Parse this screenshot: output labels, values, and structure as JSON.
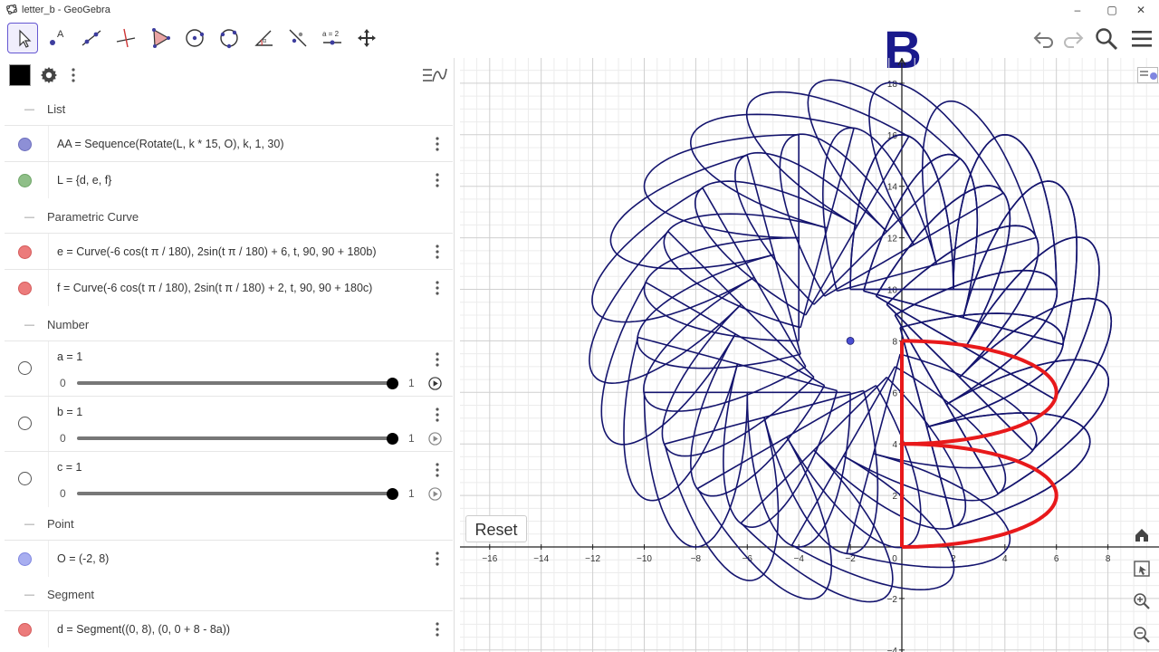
{
  "window": {
    "title": "letter_b - GeoGebra",
    "minimize": "–",
    "maximize": "▢",
    "close": "✕"
  },
  "overlay": {
    "letter": "B"
  },
  "toolbar": {
    "tools": [
      "move-tool",
      "point-tool",
      "line-tool",
      "perpendicular-line-tool",
      "polygon-tool",
      "circle-center-point-tool",
      "circle-three-points-tool",
      "angle-tool",
      "reflect-about-line-tool",
      "slider-tool",
      "move-graphics-view-tool"
    ],
    "slider_tool_label": "a = 2"
  },
  "algebra": {
    "groups": [
      {
        "name": "List",
        "items": [
          {
            "expr": "AA = Sequence(Rotate(L, k * 15, O), k, 1, 30)",
            "color": "#8d8fd6"
          },
          {
            "expr": "L = {d, e, f}",
            "color": "#8fbf88"
          }
        ]
      },
      {
        "name": "Parametric Curve",
        "items": [
          {
            "expr": "e = Curve(-6 cos(t π / 180), 2sin(t π / 180) + 6, t, 90, 90 + 180b)",
            "color": "#ec7b7b"
          },
          {
            "expr": "f = Curve(-6 cos(t π / 180), 2sin(t π / 180) + 2, t, 90, 90 + 180c)",
            "color": "#ec7b7b"
          }
        ]
      },
      {
        "name": "Number",
        "sliders": [
          {
            "expr": "a = 1",
            "min": "0",
            "max": "1",
            "value": 1
          },
          {
            "expr": "b = 1",
            "min": "0",
            "max": "1",
            "value": 1
          },
          {
            "expr": "c = 1",
            "min": "0",
            "max": "1",
            "value": 1
          }
        ]
      },
      {
        "name": "Point",
        "items": [
          {
            "expr": "O = (-2, 8)",
            "color": "#a8aef0"
          }
        ]
      },
      {
        "name": "Segment",
        "items": [
          {
            "expr": "d = Segment((0, 8), (0, 0 + 8 - 8a))",
            "color": "#ec7b7b"
          }
        ]
      }
    ]
  },
  "graphics": {
    "reset_label": "Reset",
    "x_ticks": [
      "−16",
      "−14",
      "−12",
      "−10",
      "−8",
      "−6",
      "−4",
      "−2",
      "0",
      "2",
      "4",
      "6",
      "8"
    ],
    "y_ticks": [
      "18",
      "16",
      "14",
      "12",
      "10",
      "8",
      "6",
      "4",
      "2",
      "−2",
      "−4"
    ],
    "curve_color": "#14146e",
    "letter_color": "#e8191b",
    "point_color": "#4a4ed1",
    "rotation_step_deg": 15,
    "rotation_count": 30,
    "center": {
      "x": -2,
      "y": 8
    }
  }
}
